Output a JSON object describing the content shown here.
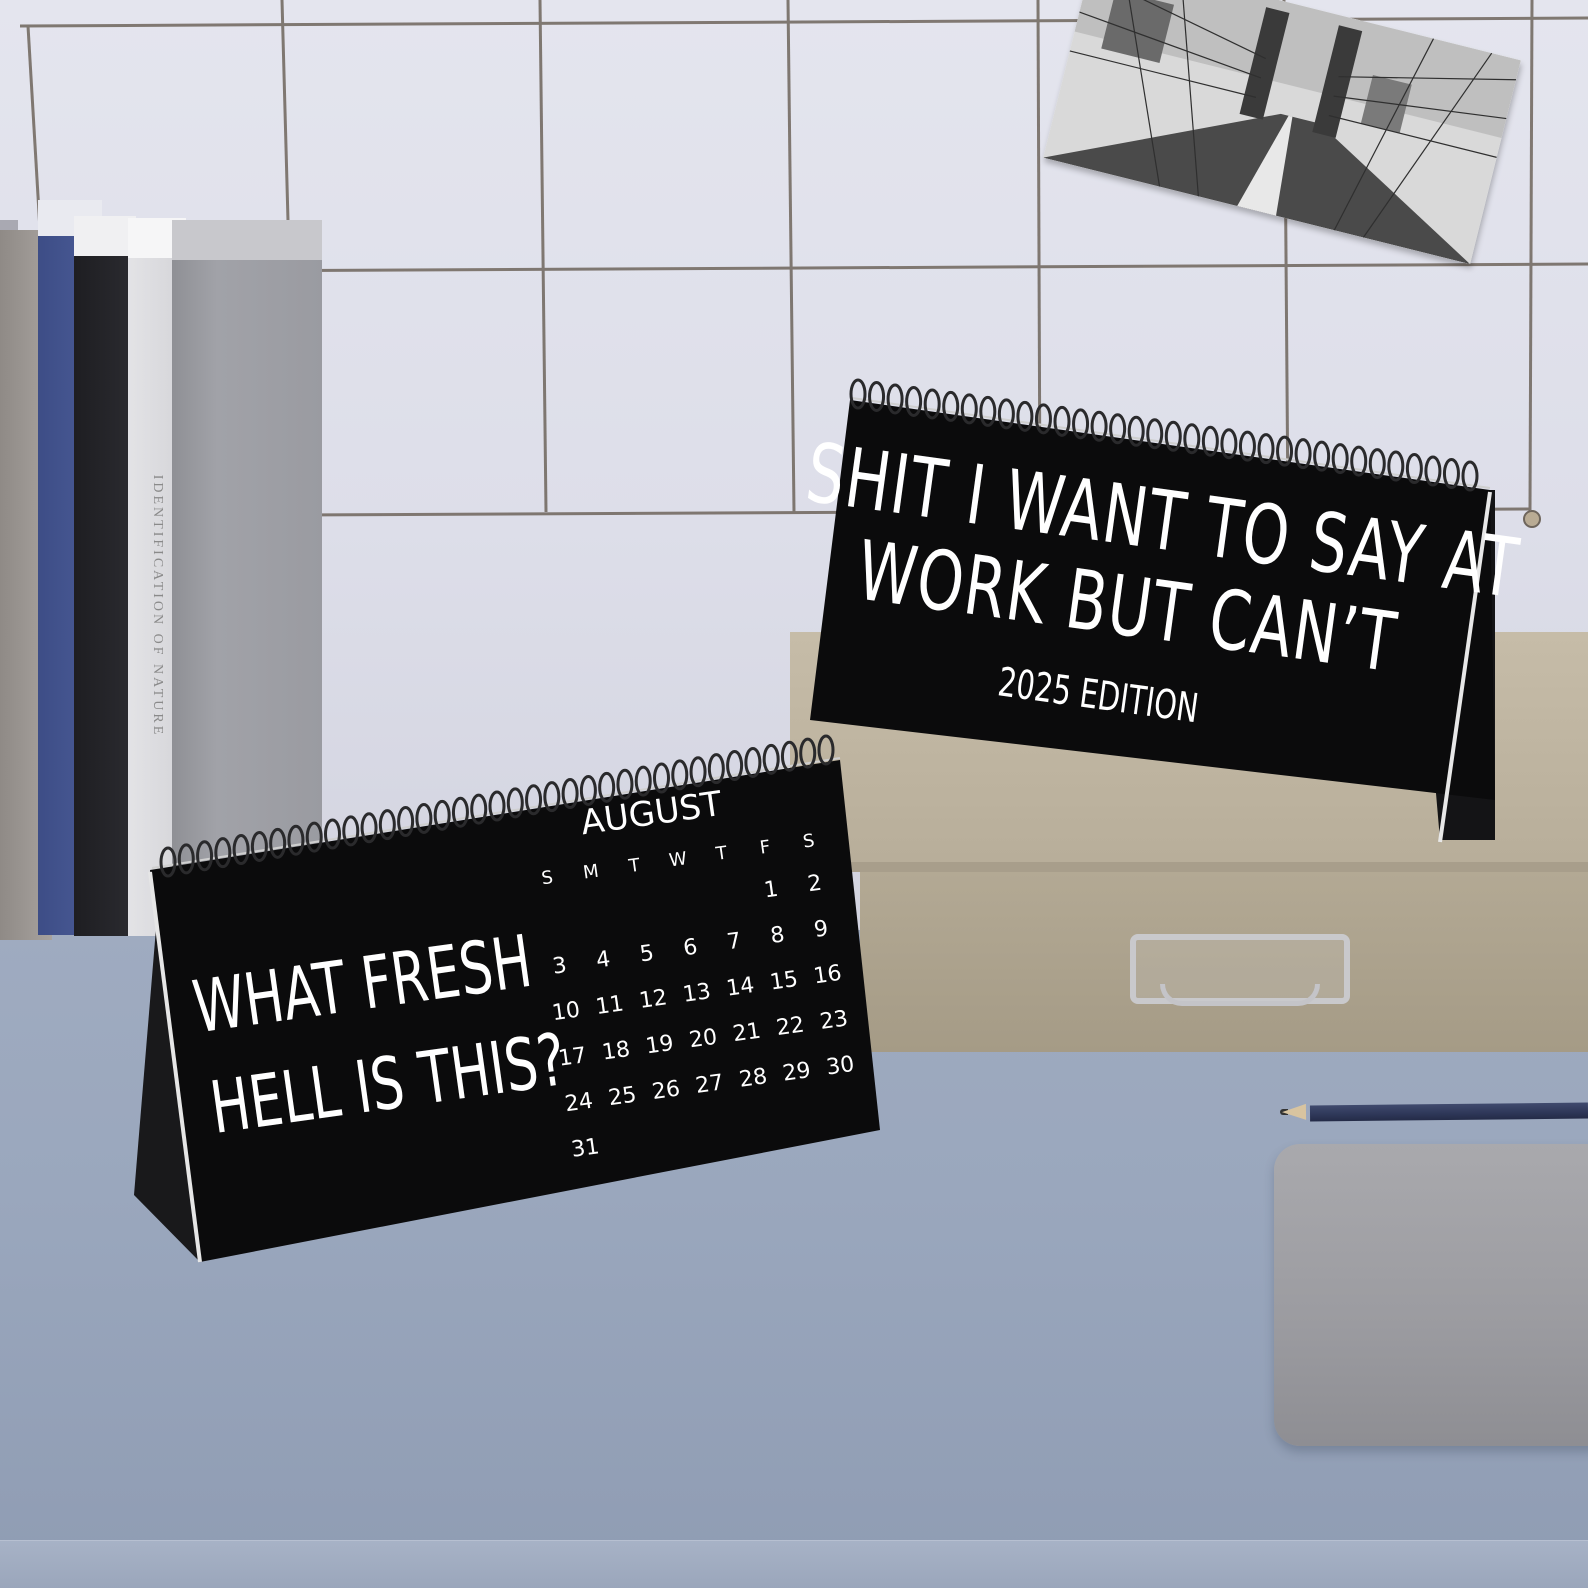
{
  "book_spine": {
    "text": "IDENTIFICATION OF NATURE"
  },
  "calendar_front": {
    "quote_lines": [
      "WHAT FRESH",
      "HELL IS THIS?"
    ],
    "month": "AUGUST",
    "weekdays": [
      "S",
      "M",
      "T",
      "W",
      "T",
      "F",
      "S"
    ],
    "weeks": [
      [
        "",
        "",
        "",
        "",
        "",
        "1",
        "2"
      ],
      [
        "3",
        "4",
        "5",
        "6",
        "7",
        "8",
        "9"
      ],
      [
        "10",
        "11",
        "12",
        "13",
        "14",
        "15",
        "16"
      ],
      [
        "17",
        "18",
        "19",
        "20",
        "21",
        "22",
        "23"
      ],
      [
        "24",
        "25",
        "26",
        "27",
        "28",
        "29",
        "30"
      ],
      [
        "31",
        "",
        "",
        "",
        "",
        "",
        ""
      ]
    ]
  },
  "calendar_back": {
    "title_lines": [
      "SHIT I WANT TO SAY AT",
      "WORK BUT CAN’T"
    ],
    "edition": "2025 EDITION"
  },
  "colors": {
    "calendar_black": "#0b0b0c",
    "wall": "#dddee9",
    "desk": "#9aa7bd",
    "grid_wire": "#6e655c",
    "box": "#b8ae9a"
  }
}
